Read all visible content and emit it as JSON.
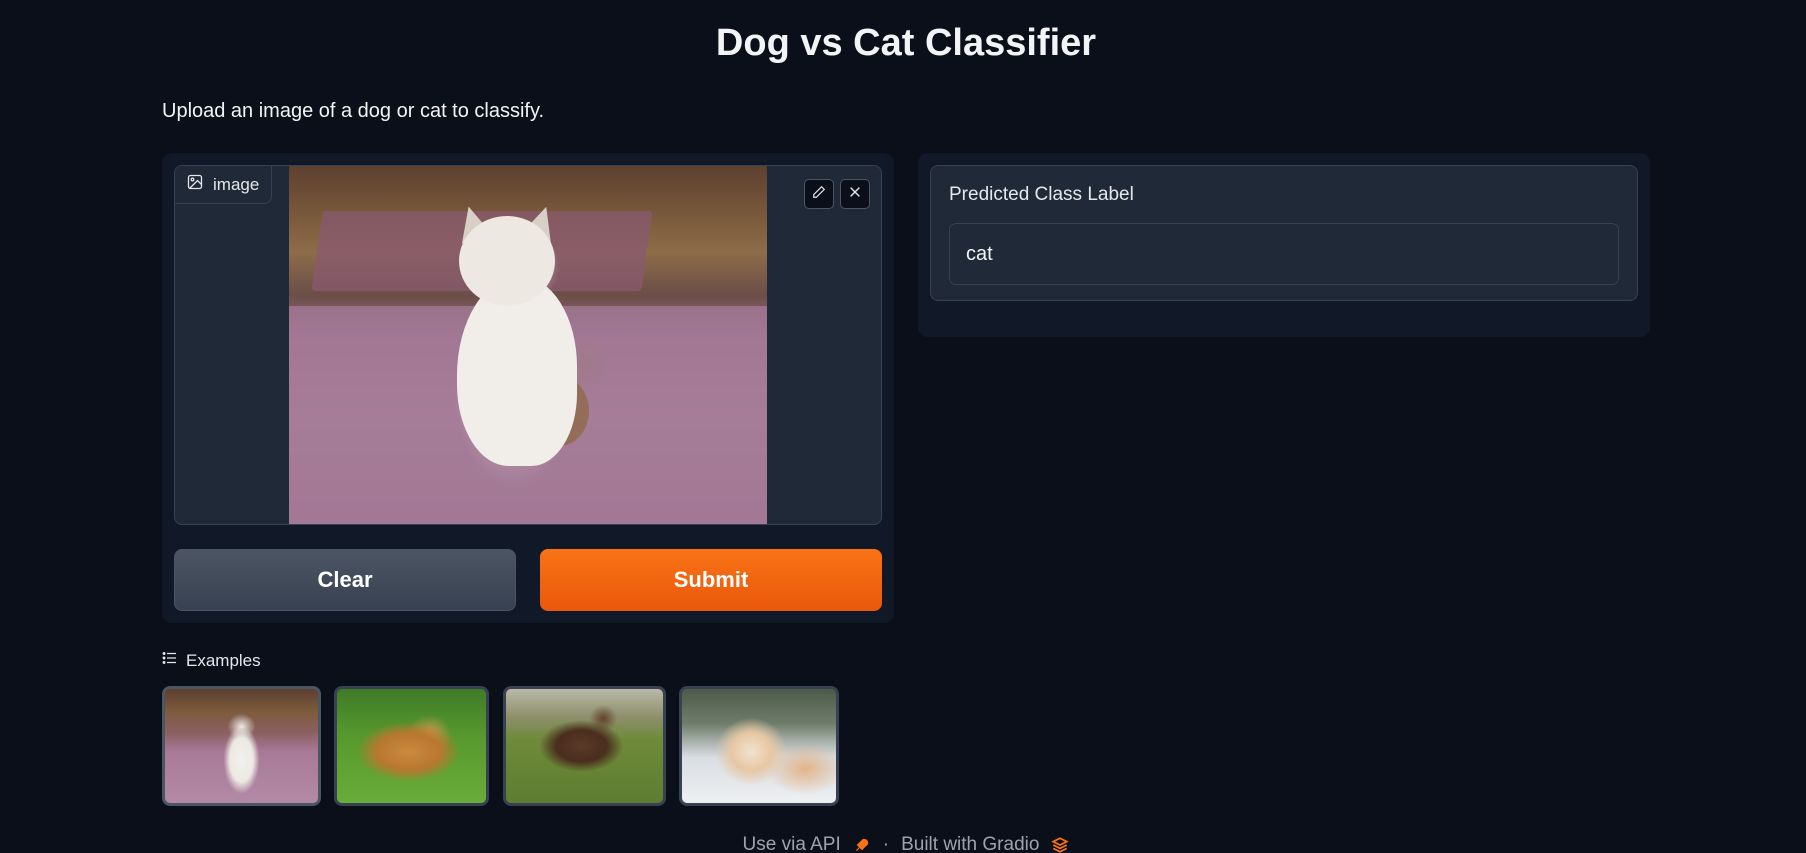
{
  "header": {
    "title": "Dog vs Cat Classifier",
    "description": "Upload an image of a dog or cat to classify."
  },
  "input": {
    "image_label": "image",
    "clear_label": "Clear",
    "submit_label": "Submit"
  },
  "output": {
    "label": "Predicted Class Label",
    "value": "cat"
  },
  "examples": {
    "label": "Examples",
    "items": [
      "cat-sitting-on-rug",
      "golden-dog-lying-on-grass",
      "brown-dog-standing",
      "orange-white-cat-window"
    ]
  },
  "footer": {
    "api_label": "Use via API",
    "separator": "·",
    "built_label": "Built with Gradio"
  },
  "colors": {
    "background": "#0b0f19",
    "panel": "#111827",
    "accent": "#f97316",
    "secondary_button": "#4b5563"
  }
}
